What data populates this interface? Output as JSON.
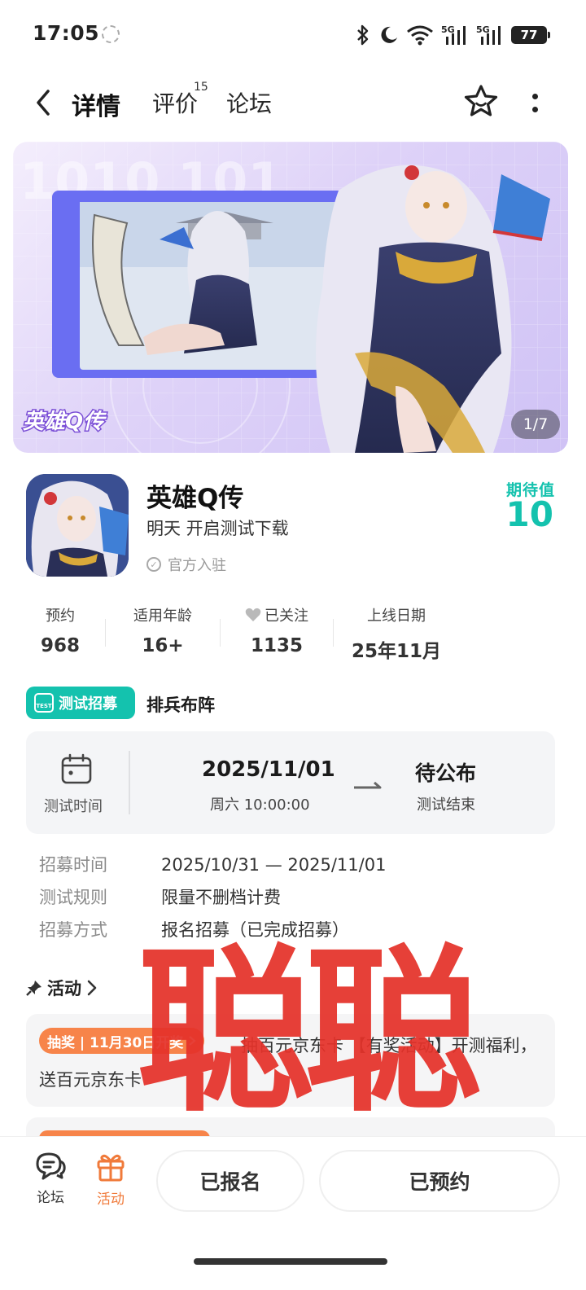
{
  "status_bar": {
    "time": "17:05",
    "battery": "77",
    "icons": [
      "alarm-clock-icon",
      "bluetooth-icon",
      "moon-icon",
      "wifi-icon",
      "5g-signal-icon",
      "5g-signal-icon",
      "battery-icon"
    ]
  },
  "nav": {
    "tabs": [
      {
        "label": "详情",
        "active": true
      },
      {
        "label": "评价",
        "badge": "15"
      },
      {
        "label": "论坛"
      }
    ],
    "accent_color": "#14c9b7"
  },
  "banner": {
    "logo_text": "英雄Q传",
    "counter": "1/7"
  },
  "game": {
    "name": "英雄Q传",
    "subtitle": "明天 开启测试下载",
    "official": "官方入驻",
    "expect_label": "期待值",
    "expect_value": "10"
  },
  "stats": [
    {
      "label": "预约",
      "value": "968"
    },
    {
      "label": "适用年龄",
      "value": "16+"
    },
    {
      "label": "已关注",
      "value": "1135"
    },
    {
      "label": "上线日期",
      "value": "25年11月"
    }
  ],
  "recruit": {
    "badge": "测试招募",
    "badge_icon_text": "TEST",
    "title": "排兵布阵",
    "test_time_label": "测试时间",
    "start_date": "2025/11/01",
    "start_time": "周六 10:00:00",
    "end_main": "待公布",
    "end_sub": "测试结束",
    "rows": [
      {
        "label": "招募时间",
        "value": "2025/10/31 — 2025/11/01"
      },
      {
        "label": "测试规则",
        "value": "限量不删档计费"
      },
      {
        "label": "招募方式",
        "value": "报名招募（已完成招募）"
      }
    ]
  },
  "activity": {
    "heading": "活动",
    "badge": "抽奖 | 11月30日开奖",
    "text": "抽百元京东卡 【有奖活动】开测福利，送百元京东卡"
  },
  "watermark": "聪聪",
  "bottom": {
    "forum": "论坛",
    "activity": "活动",
    "btn_registered": "已报名",
    "btn_reserved": "已预约"
  }
}
